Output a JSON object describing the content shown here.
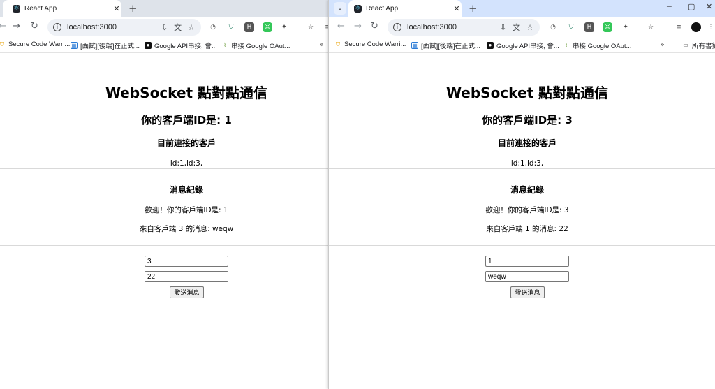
{
  "left": {
    "tab_title": "React App",
    "url": "localhost:3000",
    "bookmarks": [
      "Secure Code Warri...",
      "[面試][後端]在正式...",
      "Google API串接, 會...",
      "串接 Google OAut..."
    ],
    "app": {
      "title": "WebSocket 點對點通信",
      "client_id_heading": "你的客戶端ID是: 1",
      "connected_heading": "目前連接的客戶",
      "connected_list": "id:1,id:3,",
      "log_heading": "消息紀錄",
      "messages": [
        "歡迎！你的客戶端ID是: 1",
        "來自客戶端 3 的消息: weqw"
      ],
      "target_value": "3",
      "message_value": "22",
      "send_label": "發送消息"
    }
  },
  "right": {
    "tab_title": "React App",
    "url": "localhost:3000",
    "bookmarks": [
      "Secure Code Warri...",
      "[面試][後端]在正式...",
      "Google API串接, 會...",
      "串接 Google OAut...",
      "所有書籤"
    ],
    "app": {
      "title": "WebSocket 點對點通信",
      "client_id_heading": "你的客戶端ID是: 3",
      "connected_heading": "目前連接的客戶",
      "connected_list": "id:1,id:3,",
      "log_heading": "消息紀錄",
      "messages": [
        "歡迎！你的客戶端ID是: 3",
        "來自客戶端 1 的消息: 22"
      ],
      "target_value": "1",
      "message_value": "weqw",
      "send_label": "發送消息"
    }
  },
  "icons": {
    "plus": "+",
    "close": "✕",
    "minimize": "─",
    "maximize": "▢",
    "back": "←",
    "forward": "→",
    "reload": "↻",
    "star": "☆",
    "more": "»"
  }
}
